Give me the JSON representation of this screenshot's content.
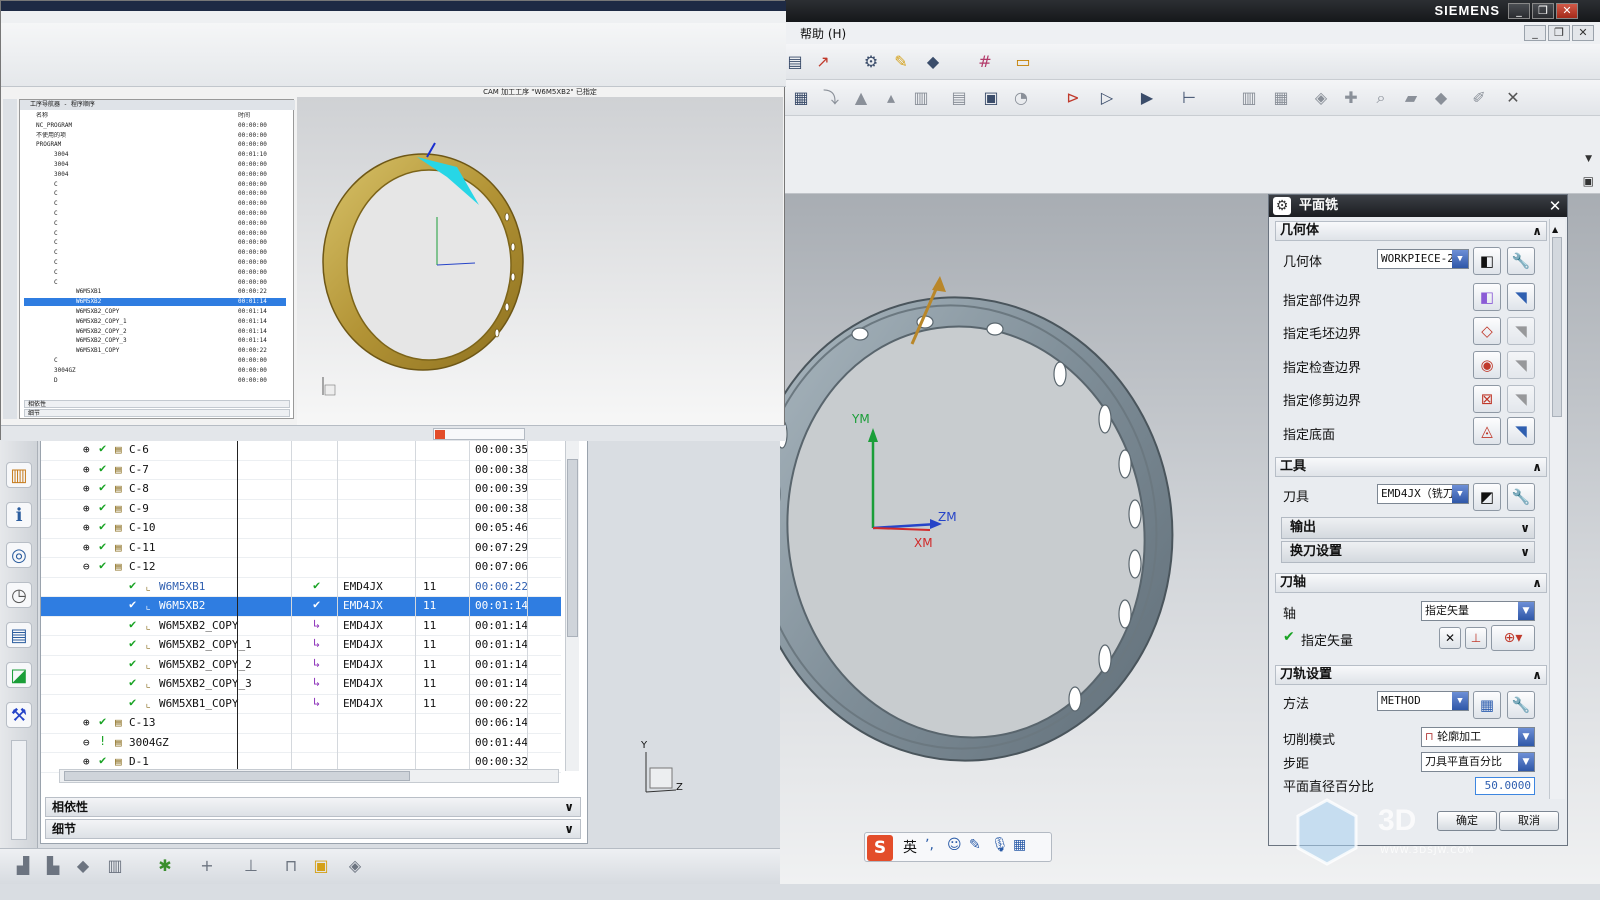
{
  "window": {
    "brand": "SIEMENS",
    "menu_help": "帮助 (H)"
  },
  "overlay": {
    "status_text": "CAM 加工工序 \"W6M5XB2\" 已指定",
    "nav_title": "工序导航器 - 程序顺序",
    "nav_col_time": "时间",
    "rows": [
      {
        "name": "名称",
        "time": "时间"
      },
      {
        "name": "NC_PROGRAM",
        "time": "00:00:00"
      },
      {
        "name": "不使用的项",
        "time": "00:00:00"
      },
      {
        "name": "PROGRAM",
        "time": "00:00:00"
      },
      {
        "name": "3004",
        "time": "00:01:10"
      },
      {
        "name": "3004",
        "time": "00:00:00"
      },
      {
        "name": "3004",
        "time": "00:00:00"
      },
      {
        "name": "C",
        "time": "00:00:00"
      },
      {
        "name": "C",
        "time": "00:00:00"
      },
      {
        "name": "C",
        "time": "00:00:00"
      },
      {
        "name": "C",
        "time": "00:00:00"
      },
      {
        "name": "C",
        "time": "00:00:00"
      },
      {
        "name": "C",
        "time": "00:00:00"
      },
      {
        "name": "C",
        "time": "00:00:00"
      },
      {
        "name": "C",
        "time": "00:00:00"
      },
      {
        "name": "C",
        "time": "00:00:00"
      },
      {
        "name": "C",
        "time": "00:00:00"
      },
      {
        "name": "C",
        "time": "00:00:00"
      },
      {
        "name": "W6M5XB1",
        "time": "00:00:22"
      },
      {
        "name": "W6M5XB2",
        "time": "00:01:14"
      },
      {
        "name": "W6M5XB2_COPY",
        "time": "00:01:14"
      },
      {
        "name": "W6M5XB2_COPY_1",
        "time": "00:01:14"
      },
      {
        "name": "W6M5XB2_COPY_2",
        "time": "00:01:14"
      },
      {
        "name": "W6M5XB2_COPY_3",
        "time": "00:01:14"
      },
      {
        "name": "W6M5XB1_COPY",
        "time": "00:00:22"
      },
      {
        "name": "C",
        "time": "00:00:00"
      },
      {
        "name": "3004GZ",
        "time": "00:00:00"
      },
      {
        "name": "D",
        "time": "00:00:00"
      }
    ],
    "dep_label": "相依性",
    "detail_label": "细节"
  },
  "navigator": {
    "rows": [
      {
        "name": "C-6",
        "time": "00:00:35",
        "tool": "",
        "num": ""
      },
      {
        "name": "C-7",
        "time": "00:00:38",
        "tool": "",
        "num": ""
      },
      {
        "name": "C-8",
        "time": "00:00:39",
        "tool": "",
        "num": ""
      },
      {
        "name": "C-9",
        "time": "00:00:38",
        "tool": "",
        "num": ""
      },
      {
        "name": "C-10",
        "time": "00:05:46",
        "tool": "",
        "num": ""
      },
      {
        "name": "C-11",
        "time": "00:07:29",
        "tool": "",
        "num": ""
      },
      {
        "name": "C-12",
        "time": "00:07:06",
        "tool": "",
        "num": ""
      },
      {
        "name": "W6M5XB1",
        "time": "00:00:22",
        "tool": "EMD4JX",
        "num": "11"
      },
      {
        "name": "W6M5XB2",
        "time": "00:01:14",
        "tool": "EMD4JX",
        "num": "11"
      },
      {
        "name": "W6M5XB2_COPY",
        "time": "00:01:14",
        "tool": "EMD4JX",
        "num": "11"
      },
      {
        "name": "W6M5XB2_COPY_1",
        "time": "00:01:14",
        "tool": "EMD4JX",
        "num": "11"
      },
      {
        "name": "W6M5XB2_COPY_2",
        "time": "00:01:14",
        "tool": "EMD4JX",
        "num": "11"
      },
      {
        "name": "W6M5XB2_COPY_3",
        "time": "00:01:14",
        "tool": "EMD4JX",
        "num": "11"
      },
      {
        "name": "W6M5XB1_COPY",
        "time": "00:00:22",
        "tool": "EMD4JX",
        "num": "11"
      },
      {
        "name": "C-13",
        "time": "00:06:14",
        "tool": "",
        "num": ""
      },
      {
        "name": "3004GZ",
        "time": "00:01:44",
        "tool": "",
        "num": ""
      },
      {
        "name": "D-1",
        "time": "00:00:32",
        "tool": "",
        "num": ""
      }
    ],
    "dependency_label": "相依性",
    "details_label": "细节"
  },
  "viewport": {
    "axis_ym": "YM",
    "axis_zm": "ZM",
    "axis_xm": "XM",
    "triad_y": "Y",
    "triad_z": "Z"
  },
  "dialog": {
    "title": "平面铣",
    "sec_geometry": "几何体",
    "geometry_label": "几何体",
    "geometry_value": "WORKPIECE-2",
    "specify_part_boundary": "指定部件边界",
    "specify_blank_boundary": "指定毛坯边界",
    "specify_check_boundary": "指定检查边界",
    "specify_trim_boundary": "指定修剪边界",
    "specify_floor": "指定底面",
    "sec_tool": "工具",
    "tool_label": "刀具",
    "tool_value": "EMD4JX（铣刀",
    "output_label": "输出",
    "tool_change_label": "换刀设置",
    "sec_tool_axis": "刀轴",
    "axis_label": "轴",
    "axis_value": "指定矢量",
    "specify_vector": "指定矢量",
    "sec_path_settings": "刀轨设置",
    "method_label": "方法",
    "method_value": "METHOD",
    "cut_pattern_label": "切削模式",
    "cut_pattern_value": "轮廓加工",
    "stepover_label": "步距",
    "stepover_value": "刀具平直百分比",
    "percent_label": "平面直径百分比",
    "percent_value": "50.0000",
    "ok_label": "确定",
    "cancel_label": "取消"
  },
  "ime": {
    "lang": "英"
  },
  "watermark": {
    "text": "3D",
    "url": "WWW.3DSJW.COM"
  },
  "colors": {
    "accent": "#2f7de1",
    "check": "#19a324",
    "part_gold": "#b99a36",
    "part_steel": "#8f9ea8"
  }
}
